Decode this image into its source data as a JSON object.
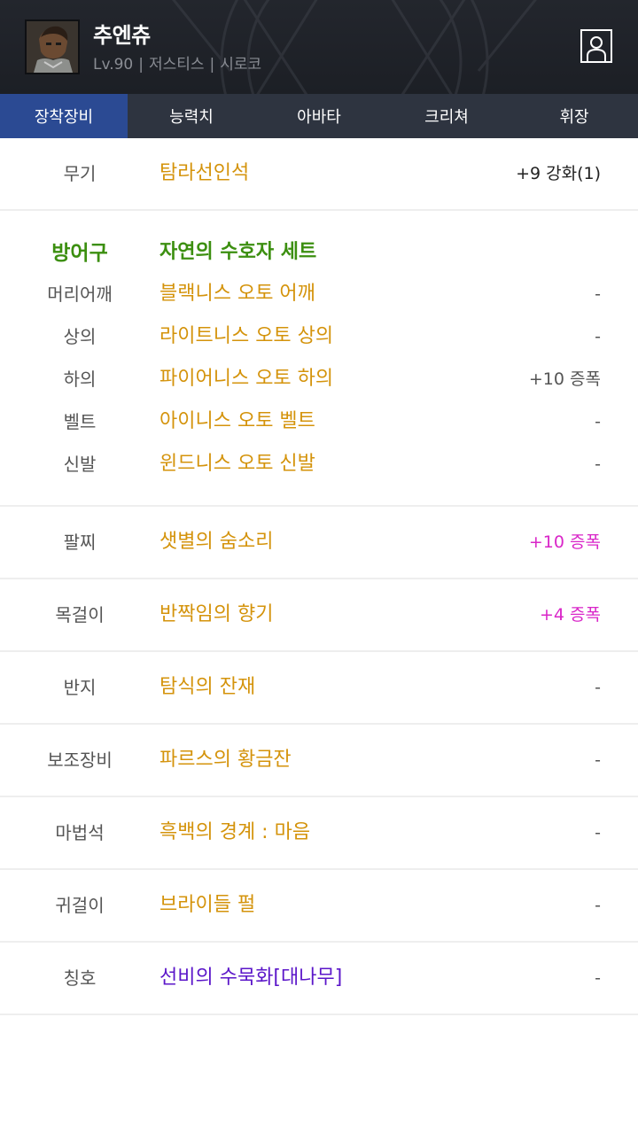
{
  "header": {
    "name": "추엔츄",
    "level": "Lv.90",
    "class": "저스티스",
    "server": "시로코",
    "separator": "|"
  },
  "tabs": [
    {
      "label": "장착장비",
      "active": true
    },
    {
      "label": "능력치",
      "active": false
    },
    {
      "label": "아바타",
      "active": false
    },
    {
      "label": "크리쳐",
      "active": false
    },
    {
      "label": "휘장",
      "active": false
    }
  ],
  "weapon": {
    "slot": "무기",
    "name": "탐라선인석",
    "extra": "+9 강화(1)"
  },
  "armor": {
    "label": "방어구",
    "set_name": "자연의 수호자 세트",
    "items": [
      {
        "slot": "머리어깨",
        "name": "블랙니스 오토 어깨",
        "extra": "-"
      },
      {
        "slot": "상의",
        "name": "라이트니스 오토 상의",
        "extra": "-"
      },
      {
        "slot": "하의",
        "name": "파이어니스 오토 하의",
        "extra": "+10 증폭"
      },
      {
        "slot": "벨트",
        "name": "아이니스 오토 벨트",
        "extra": "-"
      },
      {
        "slot": "신발",
        "name": "윈드니스 오토 신발",
        "extra": "-"
      }
    ]
  },
  "accessories": [
    {
      "slot": "팔찌",
      "name": "샛별의 숨소리",
      "extra": "+10 증폭"
    },
    {
      "slot": "목걸이",
      "name": "반짝임의 향기",
      "extra": "+4 증폭"
    },
    {
      "slot": "반지",
      "name": "탐식의 잔재",
      "extra": "-"
    },
    {
      "slot": "보조장비",
      "name": "파르스의 황금잔",
      "extra": "-"
    },
    {
      "slot": "마법석",
      "name": "흑백의 경계 : 마음",
      "extra": "-"
    },
    {
      "slot": "귀걸이",
      "name": "브라이들 펄",
      "extra": "-"
    },
    {
      "slot": "칭호",
      "name": "선비의 수묵화[대나무]",
      "extra": "-"
    }
  ],
  "colors": {
    "epic_item": "#d4930b",
    "set_green": "#3c8f10",
    "amplify_magenta": "#d926c8",
    "title_purple": "#5b16c9",
    "active_tab": "#2b4a93",
    "tab_bar": "#2e3440"
  },
  "icons": {
    "profile": "person-outline-icon",
    "avatar": "character-portrait"
  }
}
